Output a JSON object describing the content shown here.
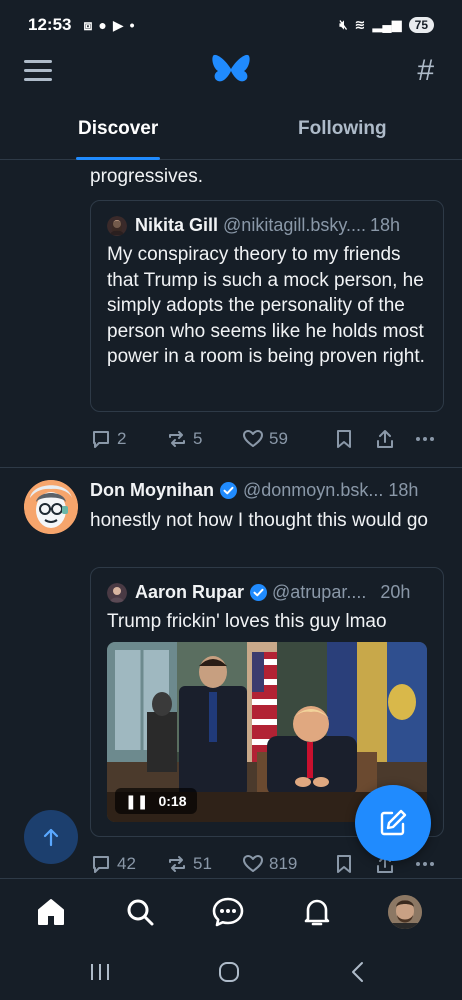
{
  "status_bar": {
    "time": "12:53",
    "battery": "75"
  },
  "tabs": [
    {
      "label": "Discover"
    },
    {
      "label": "Following"
    }
  ],
  "post1": {
    "text_tail": "progressives.",
    "quote": {
      "name": "Nikita Gill",
      "handle": "@nikitagill.bsky....",
      "time": "18h",
      "text": "My conspiracy theory to my friends that Trump is such a mock person, he simply adopts the personality of the person who seems like he holds most power in a room is being proven right."
    },
    "actions": {
      "replies": "2",
      "reposts": "5",
      "likes": "59"
    }
  },
  "post2": {
    "name": "Don Moynihan",
    "handle": "@donmoyn.bsk...",
    "time": "18h",
    "text": "honestly not how I thought this would go",
    "quote": {
      "name": "Aaron Rupar",
      "handle": "@atrupar....",
      "time": "20h",
      "text": "Trump frickin' loves this guy lmao",
      "video_duration": "0:18"
    },
    "actions": {
      "replies": "42",
      "reposts": "51",
      "likes": "819"
    }
  },
  "colors": {
    "background": "#161e27",
    "accent": "#208bfe",
    "muted": "#8a98a8",
    "border": "#2e3a47"
  }
}
